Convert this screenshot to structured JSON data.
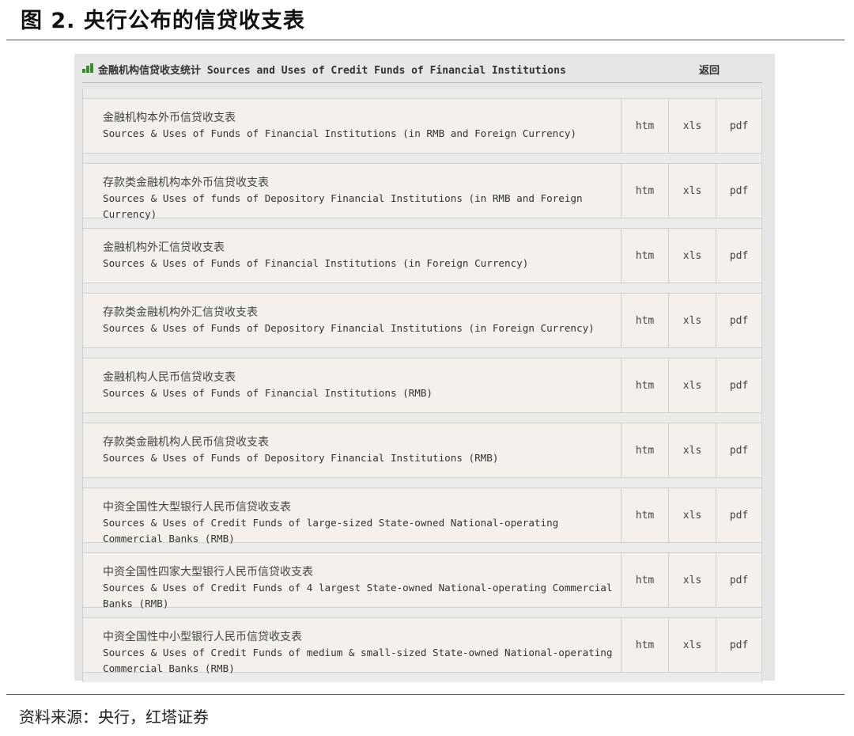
{
  "figure": {
    "title": "图 2. 央行公布的信贷收支表",
    "source": "资料来源：央行，红塔证券"
  },
  "panel": {
    "header_title": "金融机构信贷收支统计 Sources and Uses of Credit Funds of Financial Institutions",
    "back_label": "返回",
    "icon_color": "#3a8a2e"
  },
  "rows": [
    {
      "cn": "金融机构本外币信贷收支表",
      "en": "Sources & Uses of Funds of Financial Institutions (in RMB and Foreign Currency)",
      "htm": "htm",
      "xls": "xls",
      "pdf": "pdf"
    },
    {
      "cn": "存款类金融机构本外币信贷收支表",
      "en": "Sources & Uses of funds of Depository Financial Institutions (in RMB and Foreign Currency)",
      "htm": "htm",
      "xls": "xls",
      "pdf": "pdf"
    },
    {
      "cn": "金融机构外汇信贷收支表",
      "en": "Sources & Uses of Funds of Financial Institutions (in Foreign Currency)",
      "htm": "htm",
      "xls": "xls",
      "pdf": "pdf"
    },
    {
      "cn": "存款类金融机构外汇信贷收支表",
      "en": "Sources & Uses of Funds of Depository Financial Institutions (in Foreign Currency)",
      "htm": "htm",
      "xls": "xls",
      "pdf": "pdf"
    },
    {
      "cn": "金融机构人民币信贷收支表",
      "en": "Sources & Uses of Funds of Financial Institutions (RMB)",
      "htm": "htm",
      "xls": "xls",
      "pdf": "pdf"
    },
    {
      "cn": "存款类金融机构人民币信贷收支表",
      "en": "Sources & Uses of Funds of Depository Financial Institutions (RMB)",
      "htm": "htm",
      "xls": "xls",
      "pdf": "pdf"
    },
    {
      "cn": "中资全国性大型银行人民币信贷收支表",
      "en": "Sources & Uses of Credit Funds of large-sized State-owned National-operating Commercial Banks (RMB)",
      "htm": "htm",
      "xls": "xls",
      "pdf": "pdf"
    },
    {
      "cn": "中资全国性四家大型银行人民币信贷收支表",
      "en": "Sources & Uses of Credit Funds of 4 largest State-owned National-operating Commercial Banks (RMB)",
      "htm": "htm",
      "xls": "xls",
      "pdf": "pdf"
    },
    {
      "cn": "中资全国性中小型银行人民币信贷收支表",
      "en": "Sources & Uses of Credit Funds of medium & small-sized State-owned National-operating Commercial Banks (RMB)",
      "htm": "htm",
      "xls": "xls",
      "pdf": "pdf"
    }
  ]
}
